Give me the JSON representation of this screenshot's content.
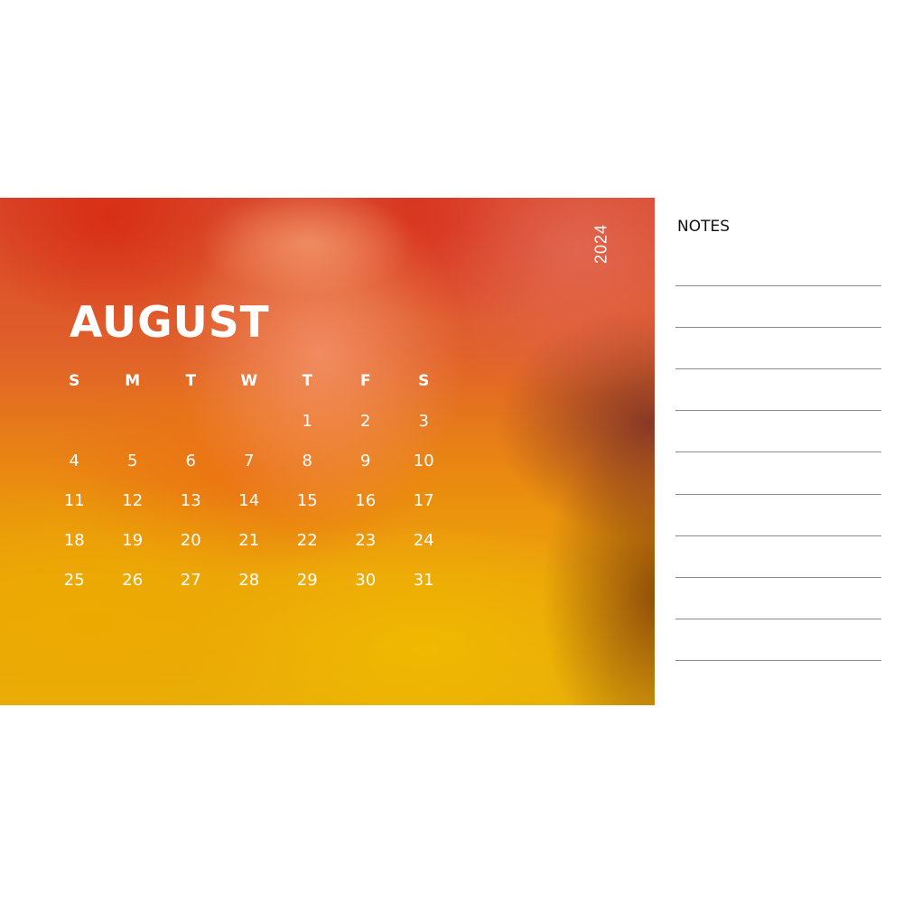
{
  "calendar": {
    "month": "AUGUST",
    "year": "2024",
    "weekday_headers": [
      "S",
      "M",
      "T",
      "W",
      "T",
      "F",
      "S"
    ],
    "leading_blank_days": 4,
    "days": [
      "1",
      "2",
      "3",
      "4",
      "5",
      "6",
      "7",
      "8",
      "9",
      "10",
      "11",
      "12",
      "13",
      "14",
      "15",
      "16",
      "17",
      "18",
      "19",
      "20",
      "21",
      "22",
      "23",
      "24",
      "25",
      "26",
      "27",
      "28",
      "29",
      "30",
      "31"
    ]
  },
  "notes": {
    "title": "NOTES",
    "line_count": 10
  },
  "colors": {
    "text_on_photo": "#ffffff",
    "notes_text": "#111111",
    "note_line": "#8a8a8a"
  }
}
